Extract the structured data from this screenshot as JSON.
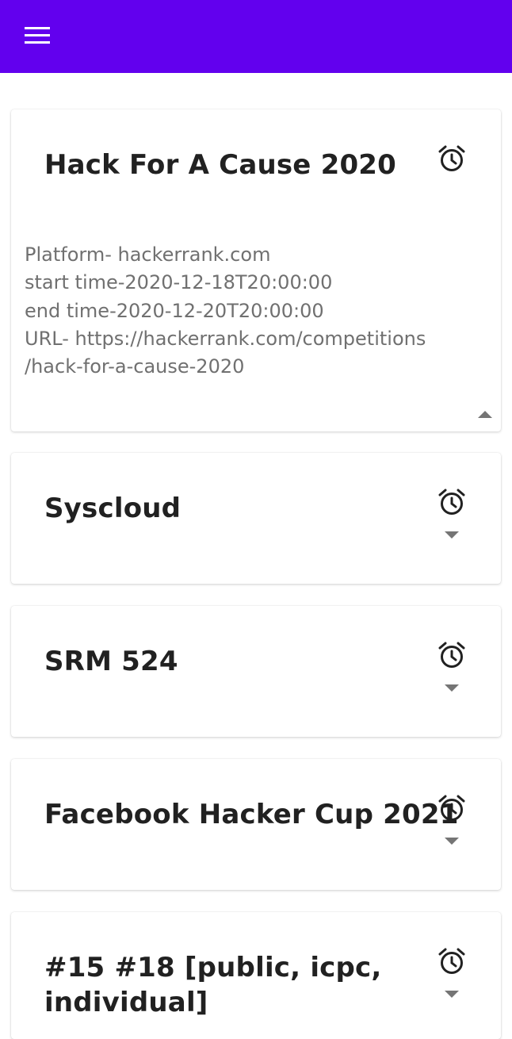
{
  "appbar": {
    "color": "#6200ee",
    "menu_icon": "hamburger-menu-icon"
  },
  "contests": [
    {
      "title": "Hack For A Cause 2020",
      "expanded": true,
      "details": {
        "platform": "Platform- hackerrank.com",
        "start": "start time-2020-12-18T20:00:00",
        "end": "end time-2020-12-20T20:00:00",
        "url_line1": "URL- https://hackerrank.com/competitions",
        "url_line2": "/hack-for-a-cause-2020"
      },
      "icon": "alarm-clock-icon",
      "toggle_icon": "chevron-up-icon"
    },
    {
      "title": "Syscloud",
      "expanded": false,
      "icon": "alarm-clock-icon",
      "toggle_icon": "chevron-down-icon"
    },
    {
      "title": "SRM 524",
      "expanded": false,
      "icon": "alarm-clock-icon",
      "toggle_icon": "chevron-down-icon"
    },
    {
      "title": "Facebook Hacker Cup 2021",
      "expanded": false,
      "icon": "alarm-clock-icon",
      "toggle_icon": "chevron-down-icon"
    },
    {
      "title": "#15 #18 [public, icpc, individual]",
      "expanded": false,
      "icon": "alarm-clock-icon",
      "toggle_icon": "chevron-down-icon"
    }
  ]
}
